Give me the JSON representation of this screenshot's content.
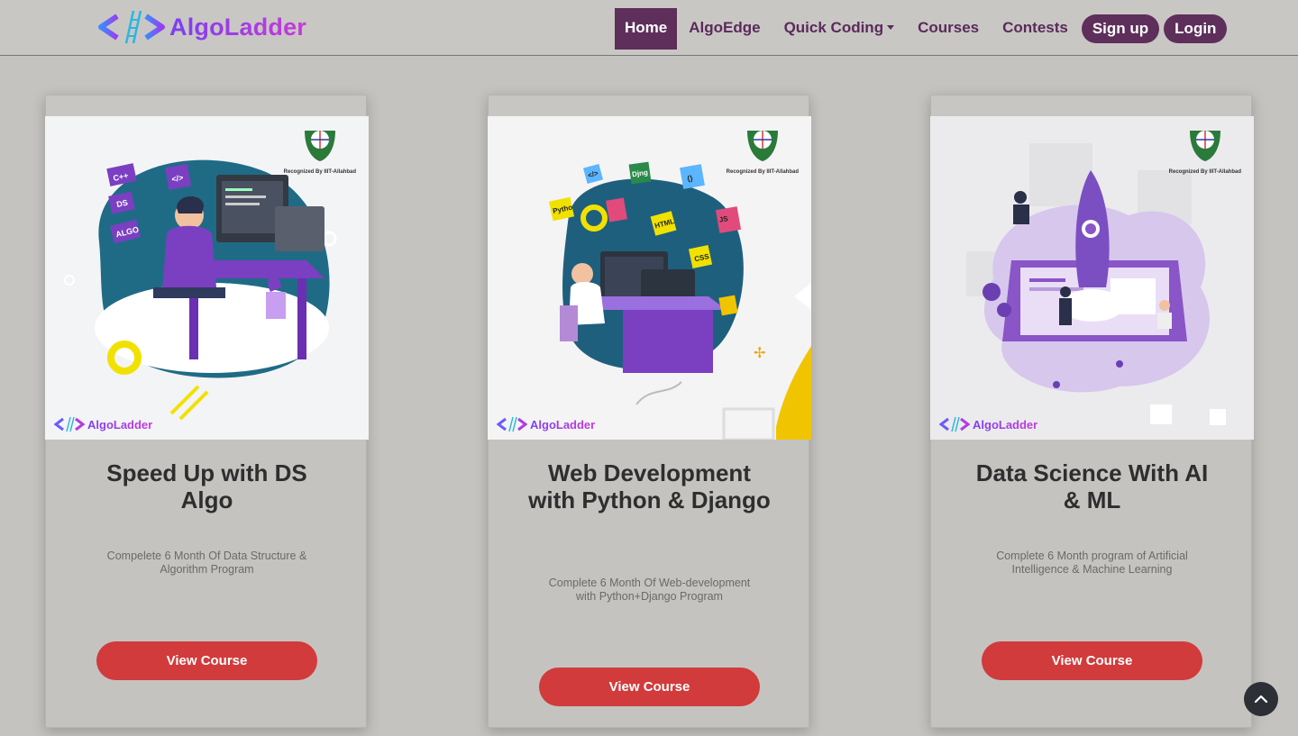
{
  "brand": {
    "name": "AlgoLadder"
  },
  "nav": {
    "items": [
      "Home",
      "AlgoEdge",
      "Quick Coding",
      "Courses",
      "Contests"
    ],
    "signup": "Sign up",
    "login": "Login"
  },
  "colors": {
    "nav_active": "#5e2f5b",
    "button": "#d13b3b",
    "background": "#c5c3c0",
    "brand_gradient": [
      "#7b3ff2",
      "#c93ad8"
    ]
  },
  "cards": [
    {
      "title": "Speed Up with DS Algo",
      "description": "Compelete 6 Month Of Data Structure & Algorithm Program",
      "button": "View Course",
      "image_badge": "Recognized By IIIT-Allahbad",
      "image_logo": "AlgoLadder",
      "tags": [
        "C++",
        "DS",
        "ALGO"
      ]
    },
    {
      "title": "Web Development with Python & Django",
      "description": "Complete 6 Month Of Web-development with Python+Django Program",
      "button": "View Course",
      "image_badge": "Recognized By IIIT-Allahbad",
      "image_logo": "AlgoLadder",
      "tags": [
        "Python",
        "Django",
        "HTML",
        "CSS",
        "Java Script"
      ]
    },
    {
      "title": "Data Science With AI & ML",
      "description": "Complete 6 Month program of Artificial Intelligence & Machine Learning",
      "button": "View Course",
      "image_badge": "Recognized By IIIT-Allahbad",
      "image_logo": "AlgoLadder",
      "tags": []
    }
  ],
  "icons": {
    "scroll_top": "chevron-up-icon",
    "dropdown": "caret-down-icon"
  }
}
